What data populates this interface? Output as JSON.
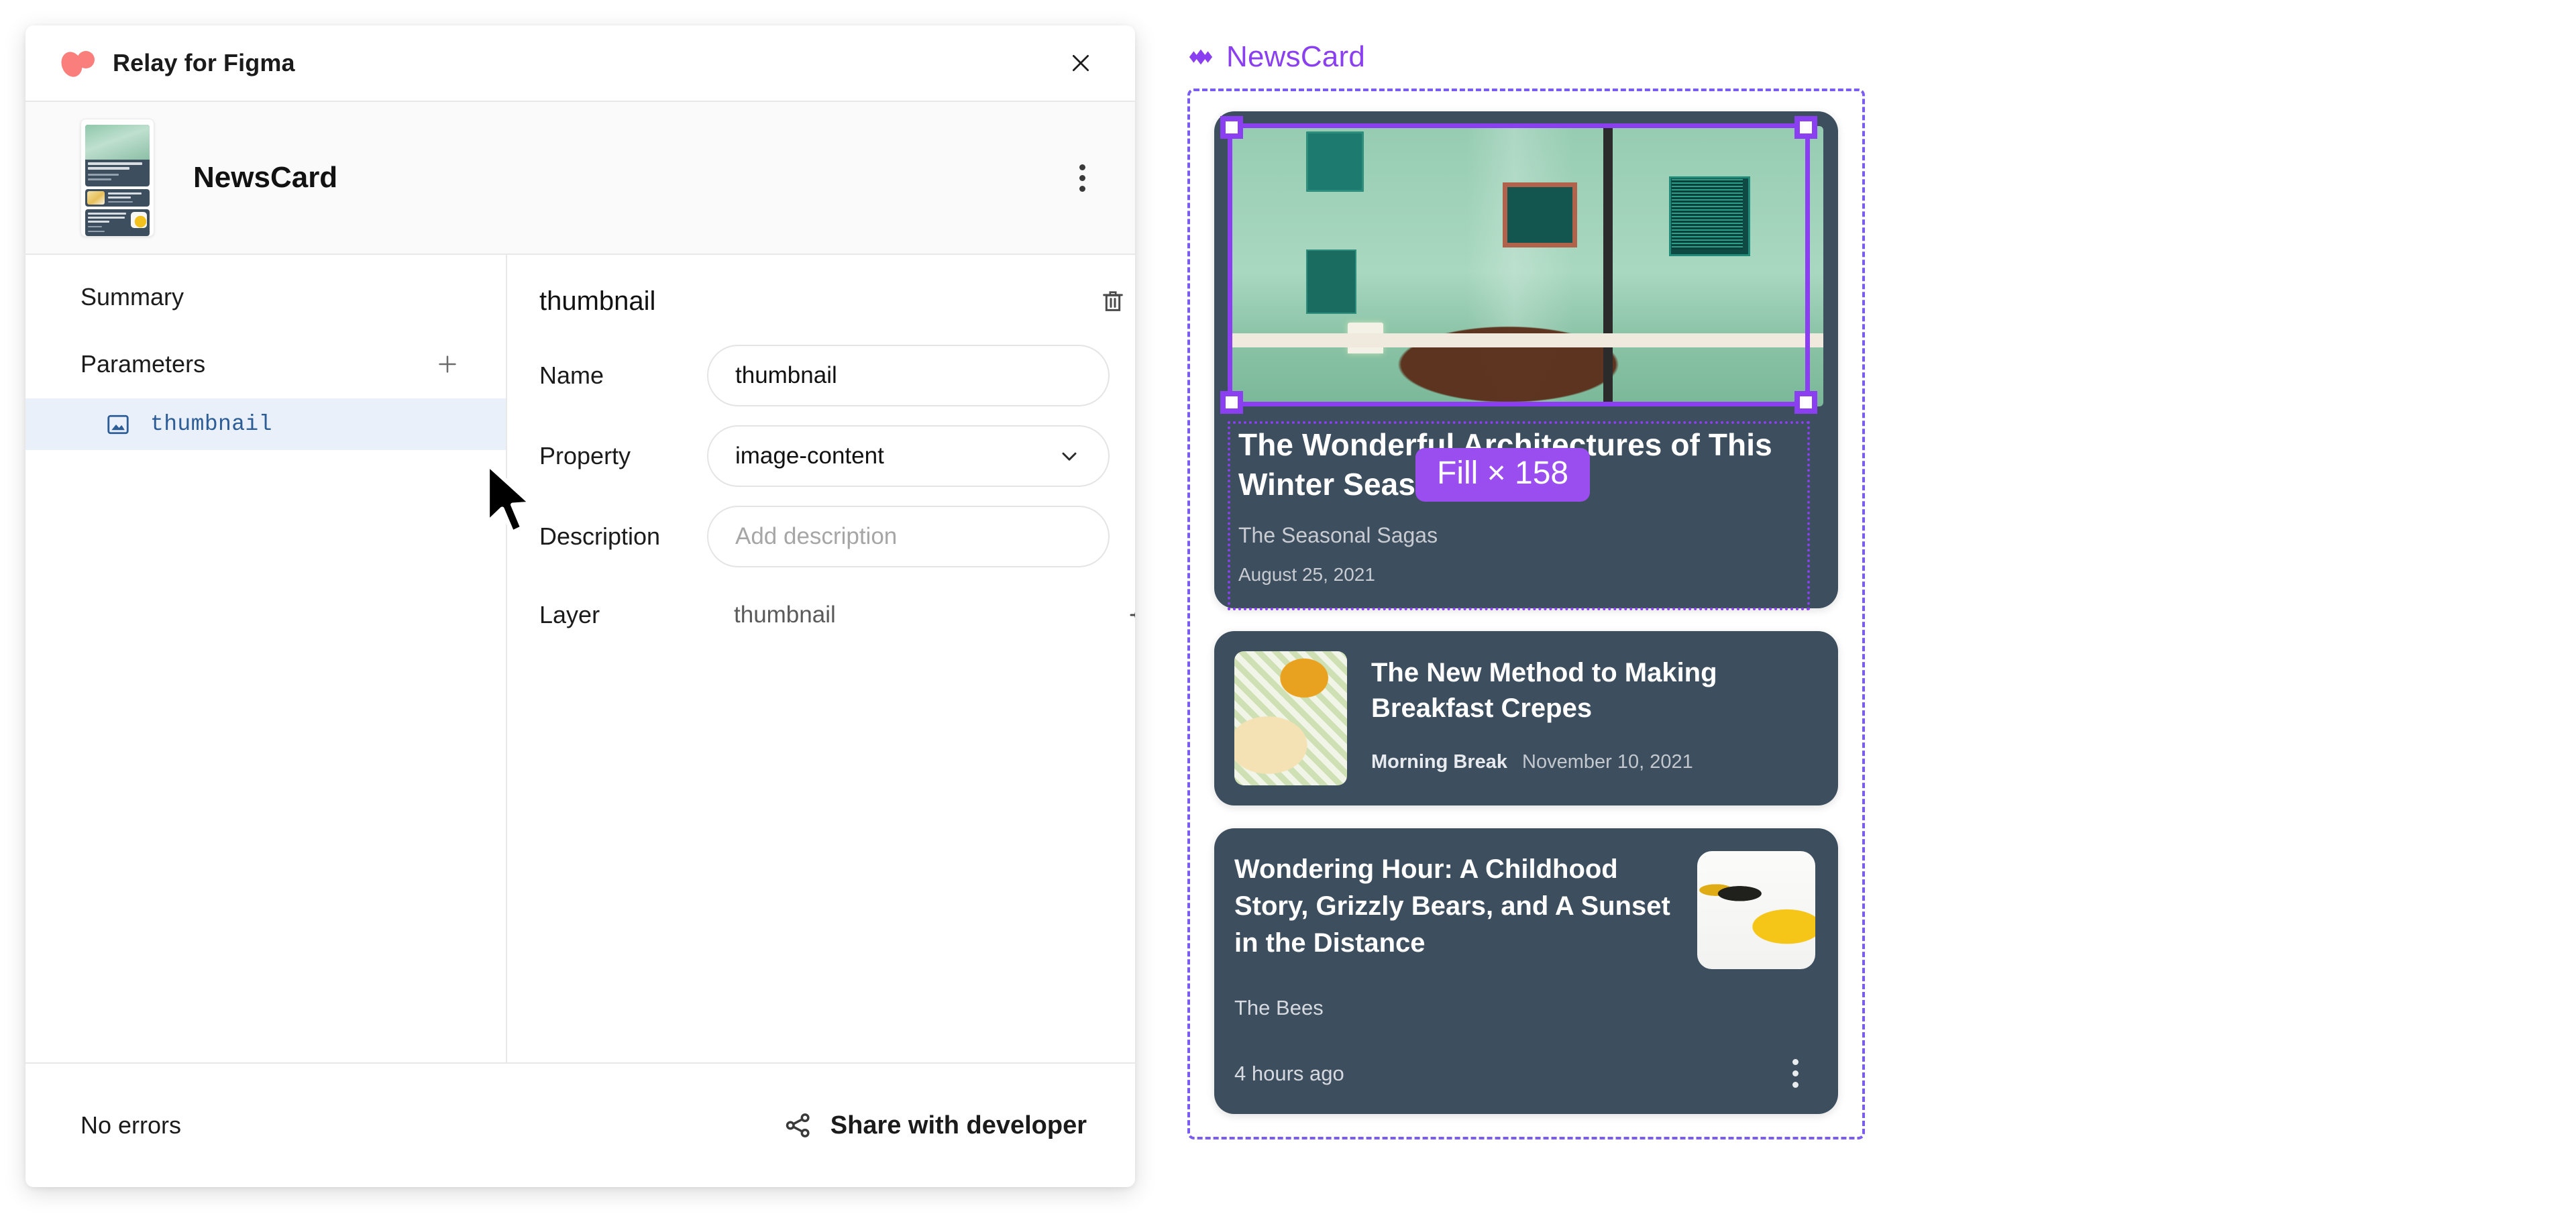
{
  "plugin": {
    "title": "Relay for Figma",
    "logo_icon": "relay-logo-icon",
    "close_icon": "close-icon",
    "component": {
      "name": "NewsCard",
      "menu_icon": "kebab-menu-icon",
      "thumbnail_icon": "component-thumbnail"
    },
    "sidebar": {
      "summary_label": "Summary",
      "parameters_label": "Parameters",
      "add_icon": "plus-icon",
      "parameters": [
        {
          "name": "thumbnail",
          "icon": "image-icon",
          "selected": true
        }
      ]
    },
    "detail": {
      "title": "thumbnail",
      "delete_icon": "trash-icon",
      "fields": [
        {
          "label": "Name",
          "value": "thumbnail",
          "placeholder": "",
          "type": "text"
        },
        {
          "label": "Property",
          "value": "image-content",
          "placeholder": "",
          "type": "select"
        },
        {
          "label": "Description",
          "value": "",
          "placeholder": "Add description",
          "type": "text"
        }
      ],
      "layer_label": "Layer",
      "layer_value": "thumbnail",
      "locate_icon": "crosshair-target-icon"
    },
    "footer": {
      "status": "No errors",
      "share_label": "Share with developer",
      "share_icon": "share-icon"
    }
  },
  "canvas": {
    "frame_name": "NewsCard",
    "frame_icon": "component-diamond-icon",
    "selection_badge": "Fill × 158",
    "accent_color": "#8a3ff0",
    "frame_border_color": "#7b5cf0",
    "badge_color": "#9a4ef0",
    "card_background": "#3d4e5e",
    "cards": [
      {
        "title": "The Wonderful Architectures of This Winter Season",
        "source": "The Seasonal Sagas",
        "date": "August 25, 2021",
        "image": "green-building-facade-photo",
        "layout": "image-top"
      },
      {
        "title": "The New Method to Making Breakfast Crepes",
        "source": "Morning Break",
        "date": "November 10, 2021",
        "image": "breakfast-crepes-photo",
        "layout": "image-left"
      },
      {
        "title": "Wondering Hour: A Childhood Story, Grizzly Bears, and A Sunset in the Distance",
        "source": "The Bees",
        "date": "4 hours ago",
        "image": "wasp-on-yellow-object-photo",
        "layout": "image-right",
        "menu_icon": "kebab-menu-icon"
      }
    ]
  },
  "pointer": {
    "icon": "mouse-cursor-arrow"
  }
}
